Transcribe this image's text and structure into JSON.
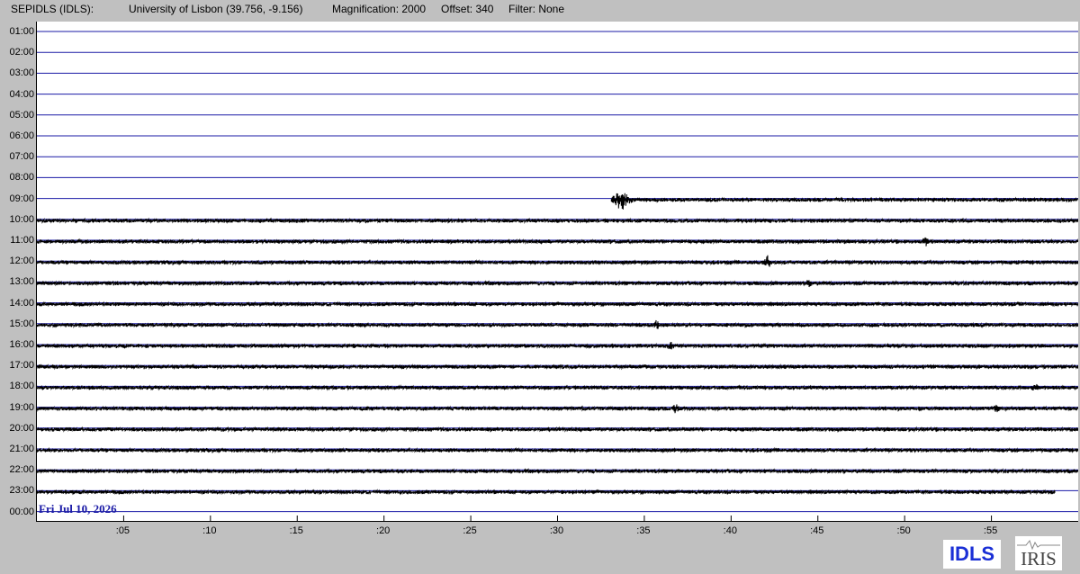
{
  "header": {
    "station": "SEPIDLS (IDLS):",
    "location": "University of Lisbon (39.756, -9.156)",
    "magnification": "Magnification: 2000",
    "offset": "Offset: 340",
    "filter": "Filter: None"
  },
  "date_label": "Fri Jul 10, 2026",
  "logos": {
    "idls": "IDLS",
    "iris": "IRIS"
  },
  "colors": {
    "background": "#c0c0c0",
    "plot_bg": "#ffffff",
    "grid_line": "#1a1aa6",
    "trace": "#000000",
    "date_text": "#1a1aa6",
    "idls_logo": "#1a2fd6"
  },
  "chart_data": {
    "type": "line",
    "hour_labels": [
      "01:00",
      "02:00",
      "03:00",
      "04:00",
      "05:00",
      "06:00",
      "07:00",
      "08:00",
      "09:00",
      "10:00",
      "11:00",
      "12:00",
      "13:00",
      "14:00",
      "15:00",
      "16:00",
      "17:00",
      "18:00",
      "19:00",
      "20:00",
      "21:00",
      "22:00",
      "23:00",
      "00:00"
    ],
    "minute_ticks": [
      ":05",
      ":10",
      ":15",
      ":20",
      ":25",
      ":30",
      ":35",
      ":40",
      ":45",
      ":50",
      ":55"
    ],
    "minute_tick_values": [
      5,
      10,
      15,
      20,
      25,
      30,
      35,
      40,
      45,
      50,
      55
    ],
    "x_range_minutes": [
      0,
      60
    ],
    "trace_start": {
      "hour": "09:00",
      "minute": 33.1
    },
    "trace_end": {
      "hour": "23:00",
      "minute": 58.7
    },
    "events": [
      {
        "hour": "09:00",
        "minute": 33.7,
        "amplitude": "large"
      },
      {
        "hour": "12:00",
        "minute": 42.1,
        "amplitude": "medium"
      },
      {
        "hour": "11:00",
        "minute": 51.2,
        "amplitude": "small"
      },
      {
        "hour": "13:00",
        "minute": 44.5,
        "amplitude": "small"
      },
      {
        "hour": "15:00",
        "minute": 35.7,
        "amplitude": "small"
      },
      {
        "hour": "16:00",
        "minute": 36.5,
        "amplitude": "small"
      },
      {
        "hour": "18:00",
        "minute": 57.5,
        "amplitude": "small"
      },
      {
        "hour": "19:00",
        "minute": 36.8,
        "amplitude": "small"
      },
      {
        "hour": "19:00",
        "minute": 55.3,
        "amplitude": "small"
      }
    ],
    "grid": true
  }
}
